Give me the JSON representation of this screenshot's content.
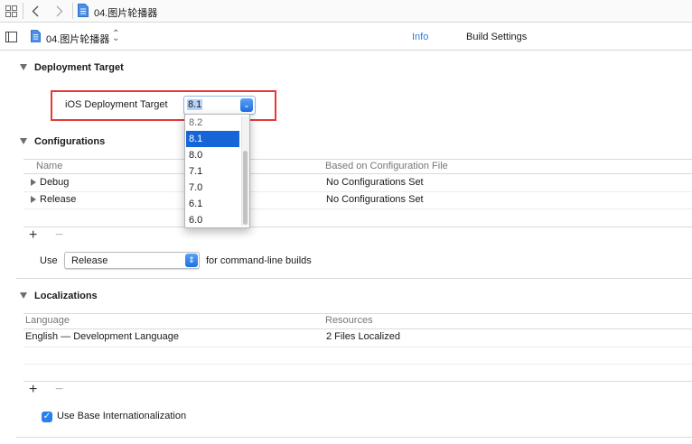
{
  "jumpbar": {
    "project_name": "04.图片轮播器"
  },
  "header": {
    "target_name": "04.图片轮播器",
    "tabs": [
      {
        "label": "Info",
        "selected": true
      },
      {
        "label": "Build Settings",
        "selected": false
      }
    ]
  },
  "deployment": {
    "section_title": "Deployment Target",
    "label": "iOS Deployment Target",
    "value": "8.1",
    "options": [
      "8.2",
      "8.1",
      "8.0",
      "7.1",
      "7.0",
      "6.1",
      "6.0"
    ],
    "selected_option": "8.1"
  },
  "configurations": {
    "section_title": "Configurations",
    "columns": [
      "Name",
      "Based on Configuration File"
    ],
    "rows": [
      {
        "name": "Debug",
        "file": "No Configurations Set"
      },
      {
        "name": "Release",
        "file": "No Configurations Set"
      }
    ],
    "add_symbol": "+",
    "remove_symbol": "−",
    "use_label": "Use",
    "use_value": "Release",
    "use_suffix": "for command-line builds"
  },
  "localizations": {
    "section_title": "Localizations",
    "columns": [
      "Language",
      "Resources"
    ],
    "rows": [
      {
        "language": "English — Development Language",
        "resources": "2 Files Localized"
      }
    ],
    "add_symbol": "+",
    "remove_symbol": "−",
    "base_checkbox_label": "Use Base Internationalization",
    "base_checked": true
  },
  "colors": {
    "accent": "#1565d8",
    "highlight_box": "#e53935",
    "tab_selected": "#2f7ae5"
  }
}
